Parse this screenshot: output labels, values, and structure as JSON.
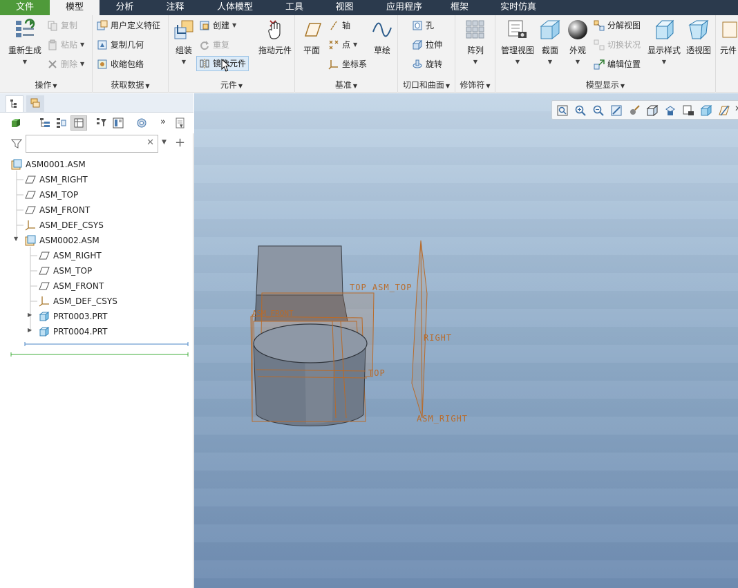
{
  "menu": {
    "items": [
      {
        "label": "文件"
      },
      {
        "label": "模型"
      },
      {
        "label": "分析"
      },
      {
        "label": "注释"
      },
      {
        "label": "人体模型"
      },
      {
        "label": "工具"
      },
      {
        "label": "视图"
      },
      {
        "label": "应用程序"
      },
      {
        "label": "框架"
      },
      {
        "label": "实时仿真"
      }
    ]
  },
  "ribbon": {
    "operations": {
      "label": "操作",
      "regenerate": "重新生成",
      "copy": "复制",
      "paste": "粘贴",
      "delete": "删除"
    },
    "get_data": {
      "label": "获取数据",
      "udf": "用户定义特征",
      "copy_geom": "复制几何",
      "shrinkwrap": "收缩包络"
    },
    "component": {
      "label": "元件",
      "assemble": "组装",
      "create": "创建",
      "repeat": "重复",
      "mirror": "镜像元件",
      "drag": "拖动元件"
    },
    "datum": {
      "label": "基准",
      "plane": "平面",
      "axis": "轴",
      "point": "点",
      "csys": "坐标系",
      "sketch": "草绘"
    },
    "cut_surface": {
      "label": "切口和曲面",
      "hole": "孔",
      "extrude": "拉伸",
      "revolve": "旋转"
    },
    "modifiers": {
      "label": "修饰符",
      "pattern": "阵列"
    },
    "model_display": {
      "label": "模型显示",
      "manage_views": "管理视图",
      "section": "截面",
      "appearance": "外观",
      "explode": "分解视图",
      "toggle_state": "切换状况",
      "edit_position": "编辑位置",
      "display_style": "显示样式",
      "perspective": "透视图"
    },
    "extra": {
      "label": "元件"
    }
  },
  "tree": {
    "filter_placeholder": "",
    "nodes": [
      {
        "label": "ASM0001.ASM"
      },
      {
        "label": "ASM_RIGHT"
      },
      {
        "label": "ASM_TOP"
      },
      {
        "label": "ASM_FRONT"
      },
      {
        "label": "ASM_DEF_CSYS"
      },
      {
        "label": "ASM0002.ASM"
      },
      {
        "label": "ASM_RIGHT"
      },
      {
        "label": "ASM_TOP"
      },
      {
        "label": "ASM_FRONT"
      },
      {
        "label": "ASM_DEF_CSYS"
      },
      {
        "label": "PRT0003.PRT"
      },
      {
        "label": "PRT0004.PRT"
      }
    ]
  },
  "viewport": {
    "labels": {
      "top_asm_top": "TOP ASM_TOP",
      "asm_front": "ASM_FRONT",
      "right": "RIGHT",
      "top": "TOP",
      "asm_right": "ASM_RIGHT"
    }
  },
  "colors": {
    "menubar": "#2b3a4d",
    "file_tab": "#4f9a3a",
    "datum": "#b86b2a"
  }
}
